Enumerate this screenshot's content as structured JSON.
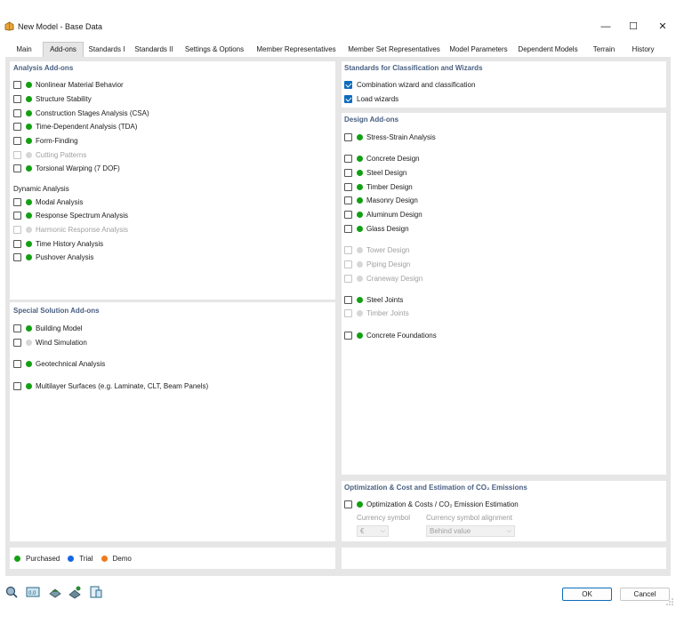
{
  "window": {
    "title": "New Model - Base Data",
    "minimize_glyph": "—",
    "maximize_glyph": "☐",
    "close_glyph": "✕"
  },
  "tabs": [
    {
      "label": "Main"
    },
    {
      "label": "Add-ons"
    },
    {
      "label": "Standards I"
    },
    {
      "label": "Standards II"
    },
    {
      "label": "Settings & Options"
    },
    {
      "label": "Member Representatives"
    },
    {
      "label": "Member Set Representatives"
    },
    {
      "label": "Model Parameters"
    },
    {
      "label": "Dependent Models"
    },
    {
      "label": "Terrain"
    },
    {
      "label": "History"
    }
  ],
  "active_tab": "Add-ons",
  "analysis": {
    "title": "Analysis Add-ons",
    "items": [
      {
        "label": "Nonlinear Material Behavior",
        "checked": false,
        "dot": "green",
        "enabled": true
      },
      {
        "label": "Structure Stability",
        "checked": false,
        "dot": "green",
        "enabled": true
      },
      {
        "label": "Construction Stages Analysis (CSA)",
        "checked": false,
        "dot": "green",
        "enabled": true
      },
      {
        "label": "Time-Dependent Analysis (TDA)",
        "checked": false,
        "dot": "green",
        "enabled": true
      },
      {
        "label": "Form-Finding",
        "checked": false,
        "dot": "green",
        "enabled": true
      },
      {
        "label": "Cutting Patterns",
        "checked": false,
        "dot": "gray",
        "enabled": false
      },
      {
        "label": "Torsional Warping (7 DOF)",
        "checked": false,
        "dot": "green",
        "enabled": true
      }
    ],
    "dynamic_title": "Dynamic Analysis",
    "dynamic_items": [
      {
        "label": "Modal Analysis",
        "checked": false,
        "dot": "green",
        "enabled": true
      },
      {
        "label": "Response Spectrum Analysis",
        "checked": false,
        "dot": "green",
        "enabled": true
      },
      {
        "label": "Harmonic Response Analysis",
        "checked": false,
        "dot": "gray",
        "enabled": false
      },
      {
        "label": "Time History Analysis",
        "checked": false,
        "dot": "green",
        "enabled": true
      },
      {
        "label": "Pushover Analysis",
        "checked": false,
        "dot": "green",
        "enabled": true
      }
    ]
  },
  "special": {
    "title": "Special Solution Add-ons",
    "items": [
      {
        "label": "Building Model",
        "checked": false,
        "dot": "green",
        "enabled": true
      },
      {
        "label": "Wind Simulation",
        "checked": false,
        "dot": "gray",
        "enabled": true
      },
      {
        "label": "Geotechnical Analysis",
        "checked": false,
        "dot": "green",
        "enabled": true
      },
      {
        "label": "Multilayer Surfaces (e.g. Laminate, CLT, Beam Panels)",
        "checked": false,
        "dot": "green",
        "enabled": true
      }
    ]
  },
  "legend": {
    "purchased": "Purchased",
    "trial": "Trial",
    "demo": "Demo",
    "colors": {
      "purchased": "#12a012",
      "trial": "#1465e6",
      "demo": "#f07a1a"
    }
  },
  "standards": {
    "title": "Standards for Classification and Wizards",
    "items": [
      {
        "label": "Combination wizard and classification",
        "checked": true
      },
      {
        "label": "Load wizards",
        "checked": true
      }
    ]
  },
  "design": {
    "title": "Design Add-ons",
    "items": [
      {
        "label": "Stress-Strain Analysis",
        "checked": false,
        "dot": "green",
        "enabled": true
      },
      {
        "label": "Concrete Design",
        "checked": false,
        "dot": "green",
        "enabled": true
      },
      {
        "label": "Steel Design",
        "checked": false,
        "dot": "green",
        "enabled": true
      },
      {
        "label": "Timber Design",
        "checked": false,
        "dot": "green",
        "enabled": true
      },
      {
        "label": "Masonry Design",
        "checked": false,
        "dot": "green",
        "enabled": true
      },
      {
        "label": "Aluminum Design",
        "checked": false,
        "dot": "green",
        "enabled": true
      },
      {
        "label": "Glass Design",
        "checked": false,
        "dot": "green",
        "enabled": true
      },
      {
        "label": "Tower Design",
        "checked": false,
        "dot": "gray",
        "enabled": false
      },
      {
        "label": "Piping Design",
        "checked": false,
        "dot": "gray",
        "enabled": false
      },
      {
        "label": "Craneway Design",
        "checked": false,
        "dot": "gray",
        "enabled": false
      },
      {
        "label": "Steel Joints",
        "checked": false,
        "dot": "green",
        "enabled": true
      },
      {
        "label": "Timber Joints",
        "checked": false,
        "dot": "gray",
        "enabled": false
      },
      {
        "label": "Concrete Foundations",
        "checked": false,
        "dot": "green",
        "enabled": true
      }
    ]
  },
  "optimization": {
    "title": "Optimization & Cost and Estimation of CO₂ Emissions",
    "item": {
      "label": "Optimization & Costs / CO₂ Emission Estimation",
      "checked": false,
      "dot": "green"
    },
    "currency_symbol_label": "Currency symbol",
    "currency_symbol_value": "€",
    "alignment_label": "Currency symbol alignment",
    "alignment_value": "Behind value"
  },
  "buttons": {
    "ok": "OK",
    "cancel": "Cancel"
  },
  "footer_icons": [
    "search-zoom-icon",
    "units-icon",
    "model-import-icon",
    "model-settings-icon",
    "model-info-icon"
  ]
}
